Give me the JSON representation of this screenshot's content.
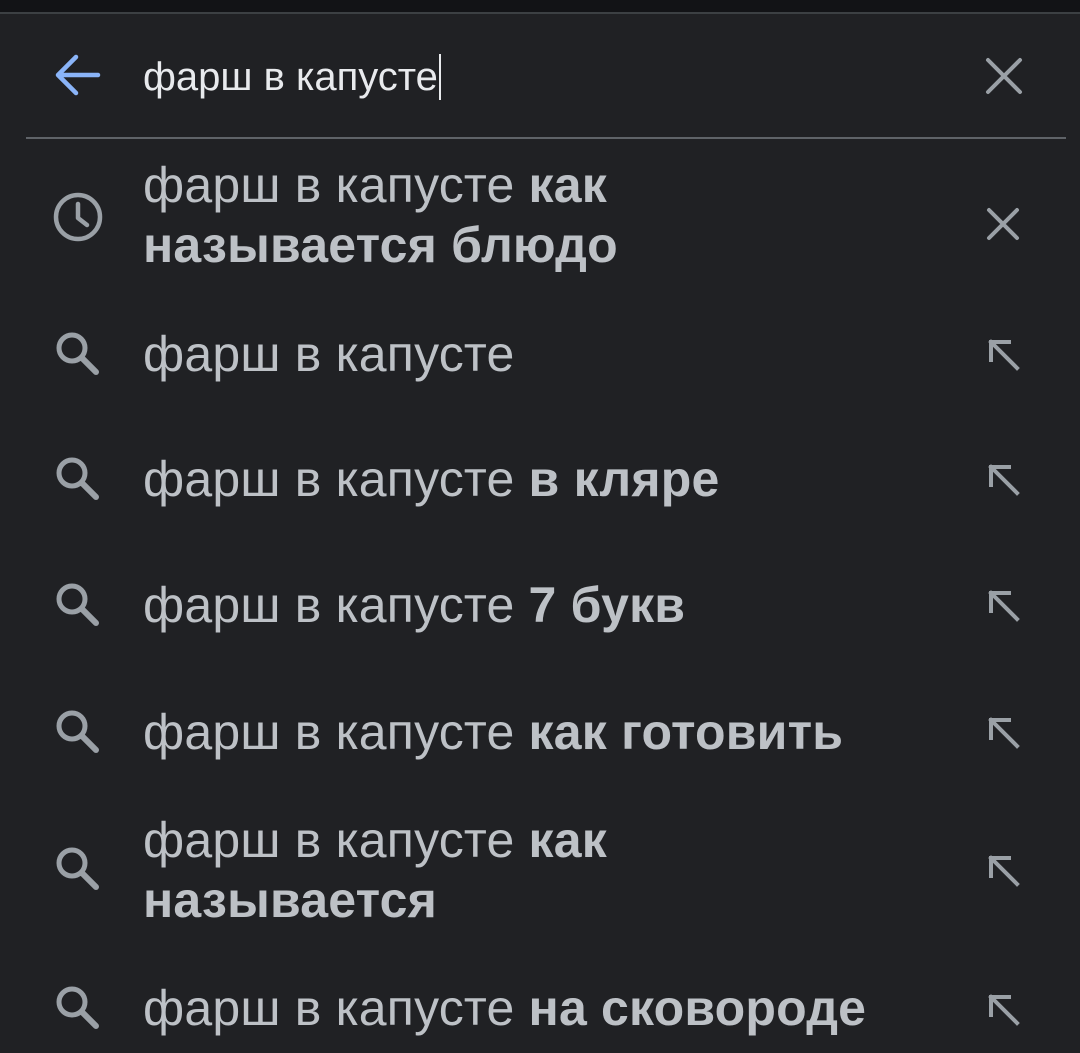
{
  "search": {
    "query": "фарш в капусте"
  },
  "colors": {
    "background": "#202124",
    "back_arrow": "#8ab4f8",
    "text": "#bdc1c6",
    "icon": "#9aa0a6"
  },
  "suggestions": [
    {
      "type": "history",
      "lead_icon": "clock-icon",
      "trail_icon": "close-icon",
      "prefix": "фарш в капусте ",
      "suffix": "как",
      "line2": "называется блюдо"
    },
    {
      "type": "search",
      "lead_icon": "search-icon",
      "trail_icon": "arrow-up-left-icon",
      "prefix": "фарш в капусте",
      "suffix": ""
    },
    {
      "type": "search",
      "lead_icon": "search-icon",
      "trail_icon": "arrow-up-left-icon",
      "prefix": "фарш в капусте ",
      "suffix": "в кляре"
    },
    {
      "type": "search",
      "lead_icon": "search-icon",
      "trail_icon": "arrow-up-left-icon",
      "prefix": "фарш в капусте ",
      "suffix": "7 букв"
    },
    {
      "type": "search",
      "lead_icon": "search-icon",
      "trail_icon": "arrow-up-left-icon",
      "prefix": "фарш в капусте ",
      "suffix": "как готовить"
    },
    {
      "type": "search",
      "lead_icon": "search-icon",
      "trail_icon": "arrow-up-left-icon",
      "prefix": "фарш в капусте ",
      "suffix": "как",
      "line2": "называется"
    },
    {
      "type": "search",
      "lead_icon": "search-icon",
      "trail_icon": "arrow-up-left-icon",
      "prefix": "фарш в капусте ",
      "suffix": "на сковороде"
    }
  ]
}
